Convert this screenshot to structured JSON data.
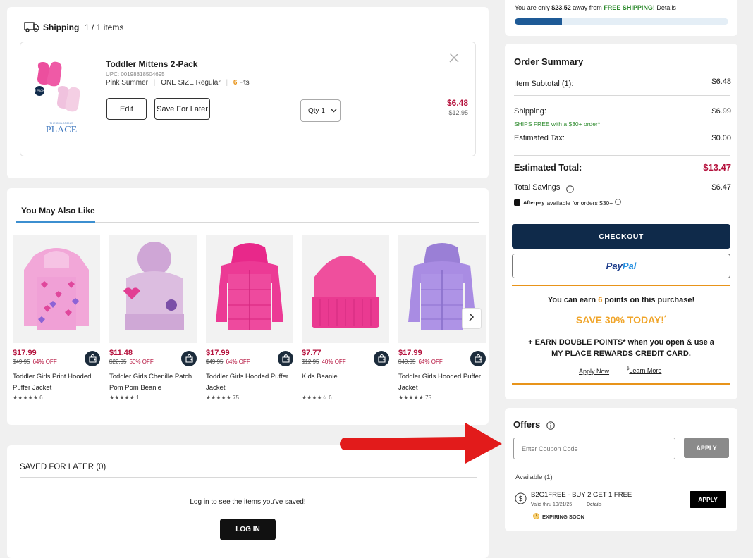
{
  "shipping": {
    "title": "Shipping",
    "count": "1 / 1 items",
    "item": {
      "name": "Toddler Mittens 2-Pack",
      "upc": "UPC: 00198818504695",
      "color": "Pink Summer",
      "size": "ONE SIZE Regular",
      "points_num": "6",
      "points_label": "Pts",
      "price": "$6.48",
      "was_price": "$12.95",
      "edit_label": "Edit",
      "save_later_label": "Save For Later",
      "qty_label": "Qty 1",
      "brand_small": "THE CHILDREN'S",
      "brand_big": "PLACE",
      "pack_badge": "2 PACK"
    }
  },
  "recs": {
    "tab_label": "You May Also Like",
    "products": [
      {
        "price": "$17.99",
        "was": "$49.95",
        "off": "64% OFF",
        "name": "Toddler Girls Print Hooded Puffer Jacket",
        "stars": "★★★★★",
        "reviews": "6",
        "color": "#e8a6d4"
      },
      {
        "price": "$11.48",
        "was": "$22.95",
        "off": "50% OFF",
        "name": "Toddler Girls Chenille Patch Pom Pom Beanie",
        "stars": "★★★★★",
        "reviews": "1",
        "color": "#d8b6dc"
      },
      {
        "price": "$17.99",
        "was": "$49.95",
        "off": "64% OFF",
        "name": "Toddler Girls Hooded Puffer Jacket",
        "stars": "★★★★★",
        "reviews": "75",
        "color": "#ea2f8e"
      },
      {
        "price": "$7.77",
        "was": "$12.95",
        "off": "40% OFF",
        "name": "Kids Beanie",
        "stars": "★★★★☆",
        "reviews": "6",
        "color": "#ef4f9d"
      },
      {
        "price": "$17.99",
        "was": "$49.95",
        "off": "64% OFF",
        "name": "Toddler Girls Hooded Puffer Jacket",
        "stars": "★★★★★",
        "reviews": "75",
        "color": "#a98ce3"
      }
    ]
  },
  "saved": {
    "title": "SAVED FOR LATER (0)",
    "message": "Log in to see the items you've saved!",
    "login_label": "LOG IN"
  },
  "free_ship": {
    "prefix": "You are only",
    "amount": "$23.52",
    "middle": "away from",
    "free": "FREE SHIPPING!",
    "details": "Details",
    "progress": 0.22
  },
  "summary": {
    "title": "Order Summary",
    "subtotal_label": "Item Subtotal (1):",
    "subtotal_value": "$6.48",
    "shipping_label": "Shipping:",
    "shipping_value": "$6.99",
    "ships_free": "SHIPS FREE with a $30+ order*",
    "tax_label": "Estimated Tax:",
    "tax_value": "$0.00",
    "total_label": "Estimated Total:",
    "total_value": "$13.47",
    "savings_label": "Total Savings",
    "savings_value": "$6.47",
    "afterpay_brand": "Afterpay",
    "afterpay_text": "available for orders $30+",
    "checkout_label": "CHECKOUT",
    "paypal_pay": "Pay",
    "paypal_pal": "Pal"
  },
  "rewards": {
    "earn_prefix": "You can earn",
    "earn_points": "6",
    "earn_suffix": "points on this purchase!",
    "save_text": "SAVE 30% TODAY!",
    "save_mark": "*",
    "double_line1": "+ EARN DOUBLE POINTS* when you open & use a",
    "double_line2": "MY PLACE REWARDS CREDIT CARD.",
    "apply_now": "Apply Now",
    "learn_prefix": "$",
    "learn_more": "Learn More"
  },
  "offers": {
    "title": "Offers",
    "coupon_placeholder": "Enter Coupon Code",
    "apply_label": "APPLY",
    "available": "Available (1)",
    "coupon_name": "B2G1FREE - BUY 2 GET 1 FREE",
    "valid": "Valid thru 10/21/25",
    "details": "Details",
    "coupon_apply": "APPLY",
    "expiring": "EXPIRING SOON"
  },
  "colors": {
    "brand_navy": "#0f2a4a",
    "price_red": "#b5123d",
    "points_orange": "#e8941a",
    "green": "#2e8b2e",
    "arrow_red": "#e21b1b"
  }
}
